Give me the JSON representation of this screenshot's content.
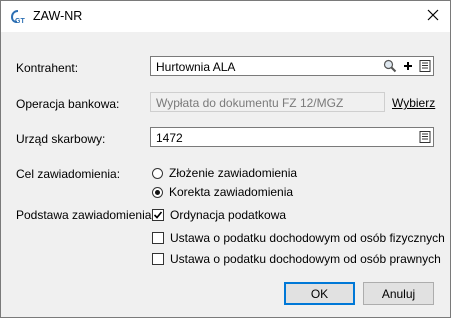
{
  "window": {
    "title": "ZAW-NR",
    "app_icon": "gt-logo-icon",
    "close_icon": "close-icon"
  },
  "form": {
    "kontrahent_label": "Kontrahent:",
    "kontrahent_value": "Hurtownia ALA",
    "operacja_label": "Operacja bankowa:",
    "operacja_value": "Wypłata do dokumentu FZ 12/MGZ",
    "operacja_link": "Wybierz",
    "urzad_label": "Urząd skarbowy:",
    "urzad_value": "1472",
    "cel_label": "Cel zawiadomienia:",
    "cel_options": [
      {
        "label": "Złożenie zawiadomienia",
        "selected": false
      },
      {
        "label": "Korekta zawiadomienia",
        "selected": true
      }
    ],
    "podstawa_label": "Podstawa zawiadomienia:",
    "podstawa_options": [
      {
        "label": "Ordynacja podatkowa",
        "checked": true
      },
      {
        "label": "Ustawa o podatku dochodowym od osób fizycznych",
        "checked": false
      },
      {
        "label": "Ustawa o podatku dochodowym od osób prawnych",
        "checked": false
      }
    ]
  },
  "buttons": {
    "ok": "OK",
    "cancel": "Anuluj"
  },
  "colors": {
    "default_button_border": "#0078d7",
    "dialog_bg": "#f0f0f0"
  }
}
